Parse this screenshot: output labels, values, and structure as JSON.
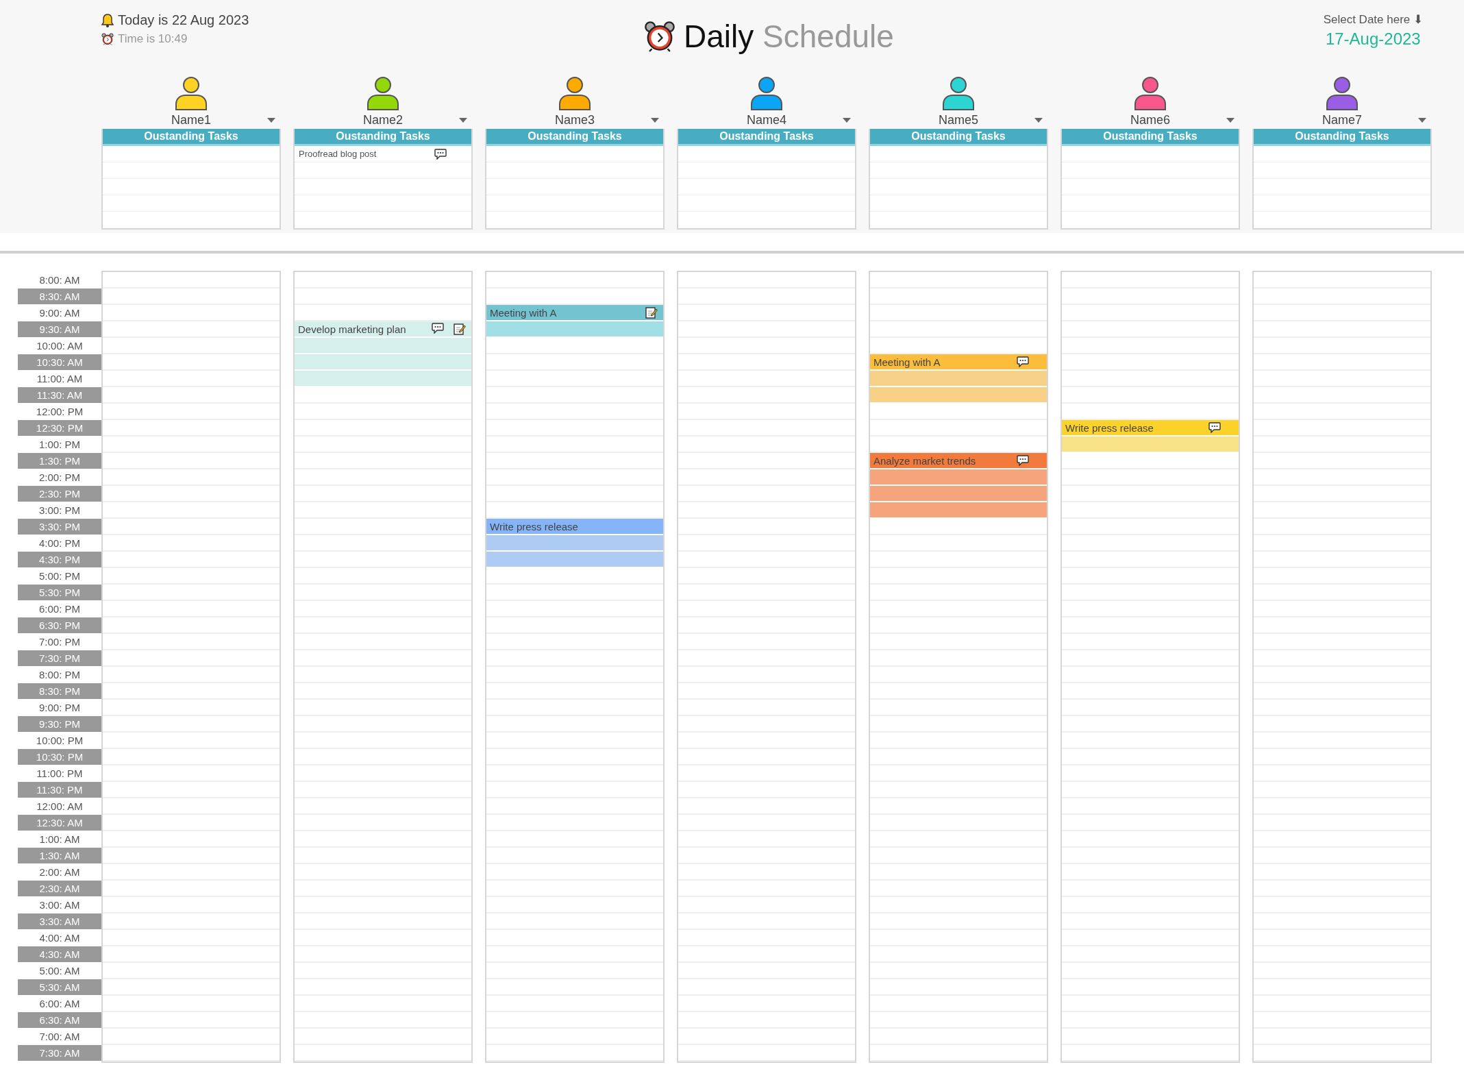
{
  "header": {
    "today": "Today is 22 Aug 2023",
    "time": "Time is 10:49",
    "title_first": "Daily",
    "title_second": "Schedule",
    "date_prompt": "Select Date here ⬇",
    "date_value": "17-Aug-2023"
  },
  "people": [
    {
      "name": "Name1",
      "color": "#ffd224",
      "tasks_title": "Oustanding Tasks"
    },
    {
      "name": "Name2",
      "color": "#94d80a",
      "tasks_title": "Oustanding Tasks",
      "tasks": [
        {
          "text": "Proofread blog post",
          "comment": true
        }
      ]
    },
    {
      "name": "Name3",
      "color": "#ffaa00",
      "tasks_title": "Oustanding Tasks"
    },
    {
      "name": "Name4",
      "color": "#0aa5f5",
      "tasks_title": "Oustanding Tasks"
    },
    {
      "name": "Name5",
      "color": "#2dd4d4",
      "tasks_title": "Oustanding Tasks"
    },
    {
      "name": "Name6",
      "color": "#f7578a",
      "tasks_title": "Oustanding Tasks"
    },
    {
      "name": "Name7",
      "color": "#9b5de5",
      "tasks_title": "Oustanding Tasks"
    }
  ],
  "rows": [
    {
      "time": "8:00: AM",
      "cells": [
        {
          "kind": "free"
        },
        {
          "kind": "free"
        },
        {
          "kind": "free"
        },
        {
          "kind": "free"
        },
        {
          "kind": "free"
        },
        {
          "kind": "free"
        },
        {
          "kind": "free"
        }
      ]
    },
    {
      "time": "8:30: AM",
      "cells": [
        {
          "kind": "free"
        },
        {
          "kind": "free"
        },
        {
          "kind": "free"
        },
        {
          "kind": "free"
        },
        {
          "kind": "free"
        },
        {
          "kind": "free"
        },
        {
          "kind": "free"
        }
      ]
    },
    {
      "time": "9:00: AM",
      "cells": [
        {
          "kind": "free"
        },
        {
          "kind": "free"
        },
        {
          "kind": "event",
          "title": "Meeting with A",
          "color": "#74c3d0",
          "comment": false,
          "note": true
        },
        {
          "kind": "free"
        },
        {
          "kind": "free"
        },
        {
          "kind": "free"
        },
        {
          "kind": "free"
        }
      ]
    },
    {
      "time": "9:30: AM",
      "cells": [
        {
          "kind": "free"
        },
        {
          "kind": "event",
          "title": "Develop marketing plan",
          "color": "#d5f0ea",
          "comment": true,
          "note": true
        },
        {
          "kind": "fill",
          "color": "#a0dfe6"
        },
        {
          "kind": "free"
        },
        {
          "kind": "free"
        },
        {
          "kind": "free"
        },
        {
          "kind": "free"
        }
      ]
    },
    {
      "time": "10:00: AM",
      "cells": [
        {
          "kind": "free"
        },
        {
          "kind": "fill",
          "color": "#d5f0ea"
        },
        {
          "kind": "free"
        },
        {
          "kind": "free"
        },
        {
          "kind": "free"
        },
        {
          "kind": "free"
        },
        {
          "kind": "free"
        }
      ]
    },
    {
      "time": "10:30: AM",
      "cells": [
        {
          "kind": "free"
        },
        {
          "kind": "fill",
          "color": "#d5f0ea"
        },
        {
          "kind": "free"
        },
        {
          "kind": "free"
        },
        {
          "kind": "event",
          "title": "Meeting with A",
          "color": "#fbbd3b",
          "comment": true,
          "note": false
        },
        {
          "kind": "free"
        },
        {
          "kind": "free"
        }
      ]
    },
    {
      "time": "11:00: AM",
      "cells": [
        {
          "kind": "free"
        },
        {
          "kind": "fill",
          "color": "#d5f0ea"
        },
        {
          "kind": "free"
        },
        {
          "kind": "free"
        },
        {
          "kind": "fill",
          "color": "#f6d187"
        },
        {
          "kind": "free"
        },
        {
          "kind": "free"
        }
      ]
    },
    {
      "time": "11:30: AM",
      "cells": [
        {
          "kind": "free"
        },
        {
          "kind": "free"
        },
        {
          "kind": "free"
        },
        {
          "kind": "free"
        },
        {
          "kind": "fill",
          "color": "#f6d187"
        },
        {
          "kind": "free"
        },
        {
          "kind": "free"
        }
      ]
    },
    {
      "time": "12:00: PM",
      "cells": [
        {
          "kind": "free"
        },
        {
          "kind": "free"
        },
        {
          "kind": "free"
        },
        {
          "kind": "free"
        },
        {
          "kind": "free"
        },
        {
          "kind": "free"
        },
        {
          "kind": "free"
        }
      ]
    },
    {
      "time": "12:30: PM",
      "cells": [
        {
          "kind": "free"
        },
        {
          "kind": "free"
        },
        {
          "kind": "free"
        },
        {
          "kind": "free"
        },
        {
          "kind": "free"
        },
        {
          "kind": "event",
          "title": "Write press release",
          "color": "#fdd22a",
          "comment": true,
          "note": false
        },
        {
          "kind": "free"
        }
      ]
    },
    {
      "time": "1:00: PM",
      "cells": [
        {
          "kind": "free"
        },
        {
          "kind": "free"
        },
        {
          "kind": "free"
        },
        {
          "kind": "free"
        },
        {
          "kind": "free"
        },
        {
          "kind": "fill",
          "color": "#f8e288"
        },
        {
          "kind": "free"
        }
      ]
    },
    {
      "time": "1:30: PM",
      "cells": [
        {
          "kind": "free"
        },
        {
          "kind": "free"
        },
        {
          "kind": "free"
        },
        {
          "kind": "free"
        },
        {
          "kind": "event",
          "title": "Analyze market trends",
          "color": "#f27a3c",
          "comment": true,
          "note": false
        },
        {
          "kind": "free"
        },
        {
          "kind": "free"
        }
      ]
    },
    {
      "time": "2:00: PM",
      "cells": [
        {
          "kind": "free"
        },
        {
          "kind": "free"
        },
        {
          "kind": "free"
        },
        {
          "kind": "free"
        },
        {
          "kind": "fill",
          "color": "#f6a47c"
        },
        {
          "kind": "free"
        },
        {
          "kind": "free"
        }
      ]
    },
    {
      "time": "2:30: PM",
      "cells": [
        {
          "kind": "free"
        },
        {
          "kind": "free"
        },
        {
          "kind": "free"
        },
        {
          "kind": "free"
        },
        {
          "kind": "fill",
          "color": "#f6a47c"
        },
        {
          "kind": "free"
        },
        {
          "kind": "free"
        }
      ]
    },
    {
      "time": "3:00: PM",
      "cells": [
        {
          "kind": "free"
        },
        {
          "kind": "free"
        },
        {
          "kind": "free"
        },
        {
          "kind": "free"
        },
        {
          "kind": "fill",
          "color": "#f6a47c"
        },
        {
          "kind": "free"
        },
        {
          "kind": "free"
        }
      ]
    },
    {
      "time": "3:30: PM",
      "cells": [
        {
          "kind": "free"
        },
        {
          "kind": "free"
        },
        {
          "kind": "event",
          "title": "Write press release",
          "color": "#86b4f8",
          "comment": false,
          "note": false
        },
        {
          "kind": "free"
        },
        {
          "kind": "free"
        },
        {
          "kind": "free"
        },
        {
          "kind": "free"
        }
      ]
    },
    {
      "time": "4:00: PM",
      "cells": [
        {
          "kind": "free"
        },
        {
          "kind": "free"
        },
        {
          "kind": "fill",
          "color": "#aecbf4"
        },
        {
          "kind": "free"
        },
        {
          "kind": "free"
        },
        {
          "kind": "free"
        },
        {
          "kind": "free"
        }
      ]
    },
    {
      "time": "4:30: PM",
      "cells": [
        {
          "kind": "free"
        },
        {
          "kind": "free"
        },
        {
          "kind": "fill",
          "color": "#aecbf4"
        },
        {
          "kind": "free"
        },
        {
          "kind": "free"
        },
        {
          "kind": "free"
        },
        {
          "kind": "free"
        }
      ]
    },
    {
      "time": "5:00: PM",
      "cells": [
        {
          "kind": "free"
        },
        {
          "kind": "free"
        },
        {
          "kind": "free"
        },
        {
          "kind": "free"
        },
        {
          "kind": "free"
        },
        {
          "kind": "free"
        },
        {
          "kind": "free"
        }
      ]
    },
    {
      "time": "5:30: PM",
      "cells": [
        {
          "kind": "free"
        },
        {
          "kind": "free"
        },
        {
          "kind": "free"
        },
        {
          "kind": "free"
        },
        {
          "kind": "free"
        },
        {
          "kind": "free"
        },
        {
          "kind": "free"
        }
      ]
    },
    {
      "time": "6:00: PM",
      "cells": [
        {
          "kind": "free"
        },
        {
          "kind": "free"
        },
        {
          "kind": "free"
        },
        {
          "kind": "free"
        },
        {
          "kind": "free"
        },
        {
          "kind": "free"
        },
        {
          "kind": "free"
        }
      ]
    },
    {
      "time": "6:30: PM",
      "cells": [
        {
          "kind": "free"
        },
        {
          "kind": "free"
        },
        {
          "kind": "free"
        },
        {
          "kind": "free"
        },
        {
          "kind": "free"
        },
        {
          "kind": "free"
        },
        {
          "kind": "free"
        }
      ]
    },
    {
      "time": "7:00: PM",
      "cells": [
        {
          "kind": "free"
        },
        {
          "kind": "free"
        },
        {
          "kind": "free"
        },
        {
          "kind": "free"
        },
        {
          "kind": "free"
        },
        {
          "kind": "free"
        },
        {
          "kind": "free"
        }
      ]
    },
    {
      "time": "7:30: PM",
      "cells": [
        {
          "kind": "free"
        },
        {
          "kind": "free"
        },
        {
          "kind": "free"
        },
        {
          "kind": "free"
        },
        {
          "kind": "free"
        },
        {
          "kind": "free"
        },
        {
          "kind": "free"
        }
      ]
    },
    {
      "time": "8:00: PM",
      "cells": [
        {
          "kind": "free"
        },
        {
          "kind": "free"
        },
        {
          "kind": "free"
        },
        {
          "kind": "free"
        },
        {
          "kind": "free"
        },
        {
          "kind": "free"
        },
        {
          "kind": "free"
        }
      ]
    },
    {
      "time": "8:30: PM",
      "cells": [
        {
          "kind": "free"
        },
        {
          "kind": "free"
        },
        {
          "kind": "free"
        },
        {
          "kind": "free"
        },
        {
          "kind": "free"
        },
        {
          "kind": "free"
        },
        {
          "kind": "free"
        }
      ]
    },
    {
      "time": "9:00: PM",
      "cells": [
        {
          "kind": "free"
        },
        {
          "kind": "free"
        },
        {
          "kind": "free"
        },
        {
          "kind": "free"
        },
        {
          "kind": "free"
        },
        {
          "kind": "free"
        },
        {
          "kind": "free"
        }
      ]
    },
    {
      "time": "9:30: PM",
      "cells": [
        {
          "kind": "free"
        },
        {
          "kind": "free"
        },
        {
          "kind": "free"
        },
        {
          "kind": "free"
        },
        {
          "kind": "free"
        },
        {
          "kind": "free"
        },
        {
          "kind": "free"
        }
      ]
    },
    {
      "time": "10:00: PM",
      "cells": [
        {
          "kind": "free"
        },
        {
          "kind": "free"
        },
        {
          "kind": "free"
        },
        {
          "kind": "free"
        },
        {
          "kind": "free"
        },
        {
          "kind": "free"
        },
        {
          "kind": "free"
        }
      ]
    },
    {
      "time": "10:30: PM",
      "cells": [
        {
          "kind": "free"
        },
        {
          "kind": "free"
        },
        {
          "kind": "free"
        },
        {
          "kind": "free"
        },
        {
          "kind": "free"
        },
        {
          "kind": "free"
        },
        {
          "kind": "free"
        }
      ]
    },
    {
      "time": "11:00: PM",
      "cells": [
        {
          "kind": "free"
        },
        {
          "kind": "free"
        },
        {
          "kind": "free"
        },
        {
          "kind": "free"
        },
        {
          "kind": "free"
        },
        {
          "kind": "free"
        },
        {
          "kind": "free"
        }
      ]
    },
    {
      "time": "11:30: PM",
      "cells": [
        {
          "kind": "free"
        },
        {
          "kind": "free"
        },
        {
          "kind": "free"
        },
        {
          "kind": "free"
        },
        {
          "kind": "free"
        },
        {
          "kind": "free"
        },
        {
          "kind": "free"
        }
      ]
    },
    {
      "time": "12:00: AM",
      "cells": [
        {
          "kind": "free"
        },
        {
          "kind": "free"
        },
        {
          "kind": "free"
        },
        {
          "kind": "free"
        },
        {
          "kind": "free"
        },
        {
          "kind": "free"
        },
        {
          "kind": "free"
        }
      ]
    },
    {
      "time": "12:30: AM",
      "cells": [
        {
          "kind": "free"
        },
        {
          "kind": "free"
        },
        {
          "kind": "free"
        },
        {
          "kind": "free"
        },
        {
          "kind": "free"
        },
        {
          "kind": "free"
        },
        {
          "kind": "free"
        }
      ]
    },
    {
      "time": "1:00: AM",
      "cells": [
        {
          "kind": "free"
        },
        {
          "kind": "free"
        },
        {
          "kind": "free"
        },
        {
          "kind": "free"
        },
        {
          "kind": "free"
        },
        {
          "kind": "free"
        },
        {
          "kind": "free"
        }
      ]
    },
    {
      "time": "1:30: AM",
      "cells": [
        {
          "kind": "free"
        },
        {
          "kind": "free"
        },
        {
          "kind": "free"
        },
        {
          "kind": "free"
        },
        {
          "kind": "free"
        },
        {
          "kind": "free"
        },
        {
          "kind": "free"
        }
      ]
    },
    {
      "time": "2:00: AM",
      "cells": [
        {
          "kind": "free"
        },
        {
          "kind": "free"
        },
        {
          "kind": "free"
        },
        {
          "kind": "free"
        },
        {
          "kind": "free"
        },
        {
          "kind": "free"
        },
        {
          "kind": "free"
        }
      ]
    },
    {
      "time": "2:30: AM",
      "cells": [
        {
          "kind": "free"
        },
        {
          "kind": "free"
        },
        {
          "kind": "free"
        },
        {
          "kind": "free"
        },
        {
          "kind": "free"
        },
        {
          "kind": "free"
        },
        {
          "kind": "free"
        }
      ]
    },
    {
      "time": "3:00: AM",
      "cells": [
        {
          "kind": "free"
        },
        {
          "kind": "free"
        },
        {
          "kind": "free"
        },
        {
          "kind": "free"
        },
        {
          "kind": "free"
        },
        {
          "kind": "free"
        },
        {
          "kind": "free"
        }
      ]
    },
    {
      "time": "3:30: AM",
      "cells": [
        {
          "kind": "free"
        },
        {
          "kind": "free"
        },
        {
          "kind": "free"
        },
        {
          "kind": "free"
        },
        {
          "kind": "free"
        },
        {
          "kind": "free"
        },
        {
          "kind": "free"
        }
      ]
    },
    {
      "time": "4:00: AM",
      "cells": [
        {
          "kind": "free"
        },
        {
          "kind": "free"
        },
        {
          "kind": "free"
        },
        {
          "kind": "free"
        },
        {
          "kind": "free"
        },
        {
          "kind": "free"
        },
        {
          "kind": "free"
        }
      ]
    },
    {
      "time": "4:30: AM",
      "cells": [
        {
          "kind": "free"
        },
        {
          "kind": "free"
        },
        {
          "kind": "free"
        },
        {
          "kind": "free"
        },
        {
          "kind": "free"
        },
        {
          "kind": "free"
        },
        {
          "kind": "free"
        }
      ]
    },
    {
      "time": "5:00: AM",
      "cells": [
        {
          "kind": "free"
        },
        {
          "kind": "free"
        },
        {
          "kind": "free"
        },
        {
          "kind": "free"
        },
        {
          "kind": "free"
        },
        {
          "kind": "free"
        },
        {
          "kind": "free"
        }
      ]
    },
    {
      "time": "5:30: AM",
      "cells": [
        {
          "kind": "free"
        },
        {
          "kind": "free"
        },
        {
          "kind": "free"
        },
        {
          "kind": "free"
        },
        {
          "kind": "free"
        },
        {
          "kind": "free"
        },
        {
          "kind": "free"
        }
      ]
    },
    {
      "time": "6:00: AM",
      "cells": [
        {
          "kind": "free"
        },
        {
          "kind": "free"
        },
        {
          "kind": "free"
        },
        {
          "kind": "free"
        },
        {
          "kind": "free"
        },
        {
          "kind": "free"
        },
        {
          "kind": "free"
        }
      ]
    },
    {
      "time": "6:30: AM",
      "cells": [
        {
          "kind": "free"
        },
        {
          "kind": "free"
        },
        {
          "kind": "free"
        },
        {
          "kind": "free"
        },
        {
          "kind": "free"
        },
        {
          "kind": "free"
        },
        {
          "kind": "free"
        }
      ]
    },
    {
      "time": "7:00: AM",
      "cells": [
        {
          "kind": "free"
        },
        {
          "kind": "free"
        },
        {
          "kind": "free"
        },
        {
          "kind": "free"
        },
        {
          "kind": "free"
        },
        {
          "kind": "free"
        },
        {
          "kind": "free"
        }
      ]
    },
    {
      "time": "7:30: AM",
      "cells": [
        {
          "kind": "free"
        },
        {
          "kind": "free"
        },
        {
          "kind": "free"
        },
        {
          "kind": "free"
        },
        {
          "kind": "free"
        },
        {
          "kind": "free"
        },
        {
          "kind": "free"
        }
      ]
    }
  ]
}
